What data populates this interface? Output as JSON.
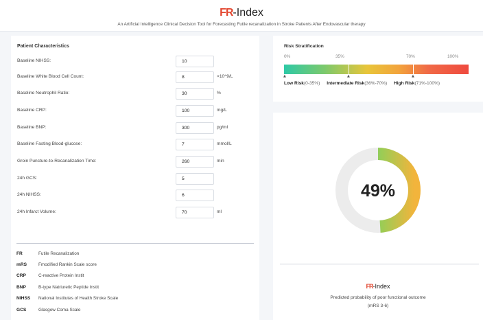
{
  "header": {
    "logo_mark": "FR",
    "logo_text": "-Index",
    "subtitle": "An Artificial Intelligence Clinical Decision Tool for Forecasting Futile recanalization in Stroke Patients After Endovascular therapy"
  },
  "patient": {
    "title": "Patient Characteristics",
    "fields": [
      {
        "label": "Baseline NIHSS:",
        "value": "10",
        "unit": ""
      },
      {
        "label": "Baseline White Blood Cell Count:",
        "value": "8",
        "unit": "×10^9/L"
      },
      {
        "label": "Baseline Neutrophil Ratio:",
        "value": "30",
        "unit": "%"
      },
      {
        "label": "Baseline CRP:",
        "value": "100",
        "unit": "mg/L"
      },
      {
        "label": "Baseline BNP:",
        "value": "300",
        "unit": "pg/ml"
      },
      {
        "label": "Baseline Fasting Blood-glucose:",
        "value": "7",
        "unit": "mmol/L"
      },
      {
        "label": "Groin Puncture-to-Recanalization Time:",
        "value": "260",
        "unit": "min"
      },
      {
        "label": "24h GCS:",
        "value": "5",
        "unit": ""
      },
      {
        "label": "24h NIHSS:",
        "value": "6",
        "unit": ""
      },
      {
        "label": "24h Infarct Volume:",
        "value": "70",
        "unit": "ml"
      }
    ]
  },
  "abbreviations": [
    {
      "abbr": "FR",
      "def": "Futile Recanalization"
    },
    {
      "abbr": "mRS",
      "def": "Fmodified Rankin Scale score"
    },
    {
      "abbr": "CRP",
      "def": "C-reactive Protein Instit"
    },
    {
      "abbr": "BNP",
      "def": "B-type Natriuretic Peptide Instit"
    },
    {
      "abbr": "NIHSS",
      "def": "National Institutes of Health Stroke Scale"
    },
    {
      "abbr": "GCS",
      "def": "Glasgow Coma Scale"
    }
  ],
  "risk": {
    "title": "Risk Stratification",
    "ticks": [
      "0%",
      "35%",
      "70%",
      "100%"
    ],
    "thresholds": [
      0.35,
      0.7
    ],
    "low": {
      "label": "Low Risk",
      "range": "(0-35%)"
    },
    "intermediate": {
      "label": "Intermediate Risk",
      "range": "(36%-70%)"
    },
    "high": {
      "label": "High Risk",
      "range": "(71%-100%)"
    }
  },
  "result": {
    "percent_text": "49%",
    "probability": 0.49,
    "logo_mark": "FR",
    "logo_text": "-Index",
    "description": "Predicted probability of poor functional outcome",
    "sub": "(mRS 3-6)"
  },
  "colors": {
    "accent": "#e2462f",
    "low": "#2ec9a6",
    "mid": "#f2b43c",
    "high": "#ef4a3f",
    "track": "#ececec"
  }
}
